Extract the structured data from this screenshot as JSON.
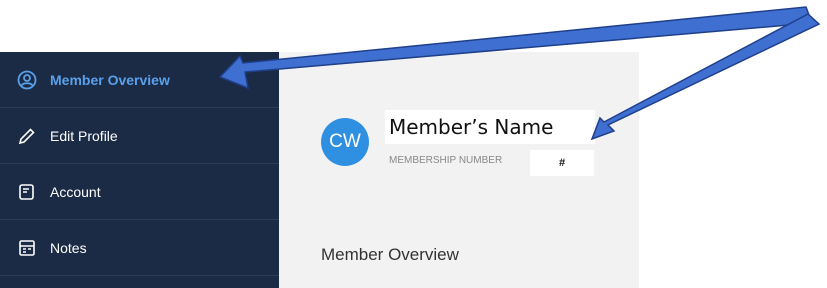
{
  "sidebar": {
    "items": [
      {
        "label": "Member Overview",
        "icon": "user-circle-icon",
        "active": true
      },
      {
        "label": "Edit Profile",
        "icon": "pencil-icon",
        "active": false
      },
      {
        "label": "Account",
        "icon": "receipt-icon",
        "active": false
      },
      {
        "label": "Notes",
        "icon": "notes-icon",
        "active": false
      }
    ]
  },
  "member": {
    "initials": "CW",
    "name": "Member’s Name",
    "number_label": "MEMBERSHIP NUMBER",
    "number_value": "#"
  },
  "main": {
    "section_title": "Member Overview"
  },
  "colors": {
    "sidebar_bg": "#1b2b45",
    "active_text": "#5aa0ea",
    "avatar_bg": "#2f8fe0",
    "arrow_fill": "#3f6fd0"
  }
}
